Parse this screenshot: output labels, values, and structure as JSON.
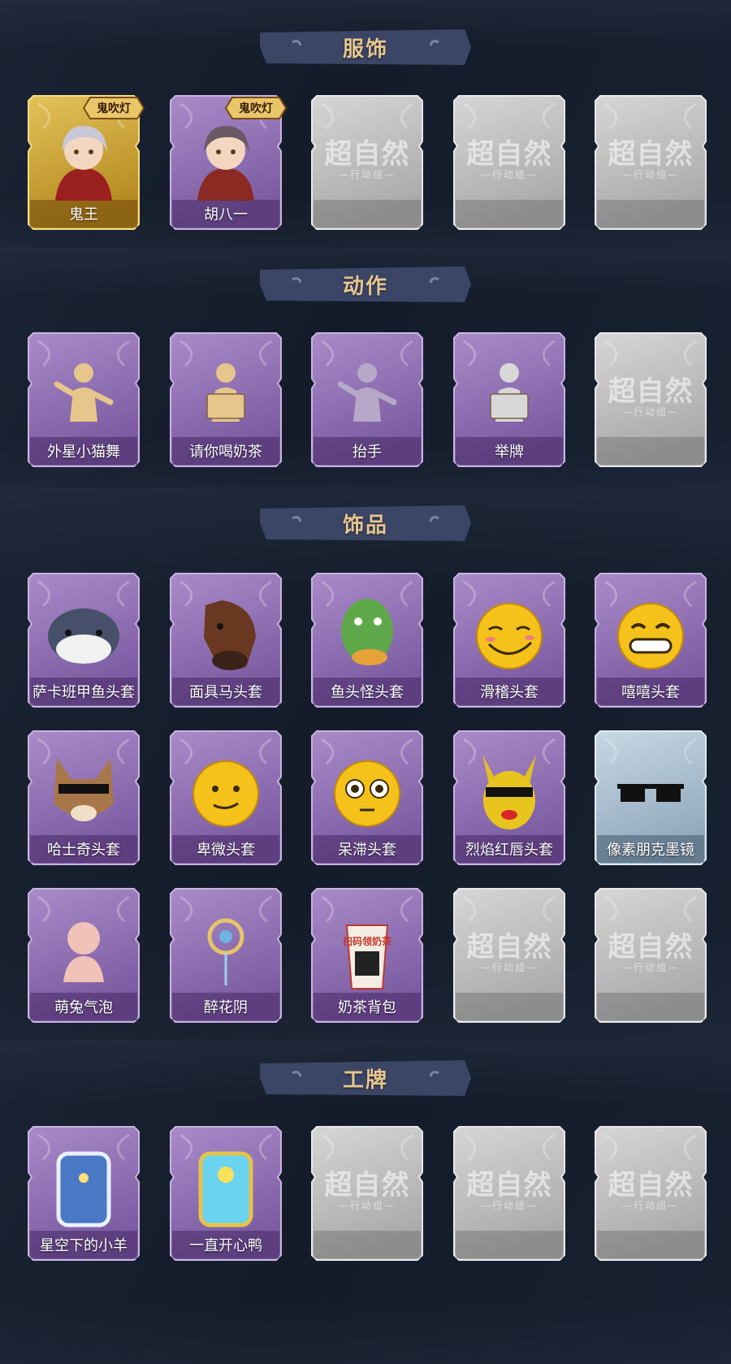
{
  "colors": {
    "background": "#141c2a",
    "title_gold": "#e8c690",
    "purple_card": "#8f6fb5",
    "gold_card": "#c99a2e",
    "blue_card": "#a9bfd0",
    "gray_card": "#c9c9c9"
  },
  "locked_watermark": {
    "main": "超自然",
    "sub": "—行动组—"
  },
  "sections": [
    {
      "title": "服饰",
      "items": [
        {
          "label": "鬼王",
          "style": "gold",
          "icon": "character-ghost-king-icon",
          "badge": "鬼吹灯"
        },
        {
          "label": "胡八一",
          "style": "purple",
          "icon": "character-hu-bayi-icon",
          "badge": "鬼吹灯"
        },
        {
          "label": "",
          "style": "locked"
        },
        {
          "label": "",
          "style": "locked"
        },
        {
          "label": "",
          "style": "locked"
        }
      ]
    },
    {
      "title": "动作",
      "items": [
        {
          "label": "外星小猫舞",
          "style": "purple",
          "icon": "dance-pose-icon"
        },
        {
          "label": "请你喝奶茶",
          "style": "purple",
          "icon": "hold-sign-pose-icon"
        },
        {
          "label": "抬手",
          "style": "purple",
          "icon": "raise-hand-pose-icon"
        },
        {
          "label": "举牌",
          "style": "purple",
          "icon": "hold-placard-pose-icon"
        },
        {
          "label": "",
          "style": "locked"
        }
      ]
    },
    {
      "title": "饰品",
      "items": [
        {
          "label": "萨卡班甲鱼头套",
          "style": "purple",
          "icon": "fish-head-mask-icon"
        },
        {
          "label": "面具马头套",
          "style": "purple",
          "icon": "horse-head-mask-icon"
        },
        {
          "label": "鱼头怪头套",
          "style": "purple",
          "icon": "green-fish-mask-icon"
        },
        {
          "label": "滑稽头套",
          "style": "purple",
          "icon": "funny-face-mask-icon"
        },
        {
          "label": "嘻嘻头套",
          "style": "purple",
          "icon": "grin-face-mask-icon"
        },
        {
          "label": "哈士奇头套",
          "style": "purple",
          "icon": "husky-mask-icon"
        },
        {
          "label": "卑微头套",
          "style": "purple",
          "icon": "humble-face-mask-icon"
        },
        {
          "label": "呆滞头套",
          "style": "purple",
          "icon": "dazed-face-mask-icon"
        },
        {
          "label": "烈焰红唇头套",
          "style": "purple",
          "icon": "pikachu-mask-icon"
        },
        {
          "label": "像素朋克墨镜",
          "style": "blue",
          "icon": "pixel-sunglasses-icon"
        },
        {
          "label": "萌兔气泡",
          "style": "purple",
          "icon": "bunny-bubble-icon"
        },
        {
          "label": "醉花阴",
          "style": "purple",
          "icon": "flower-ornament-icon"
        },
        {
          "label": "奶茶背包",
          "style": "purple",
          "icon": "milk-tea-backpack-icon",
          "icon_text": "扫码领奶茶"
        },
        {
          "label": "",
          "style": "locked"
        },
        {
          "label": "",
          "style": "locked"
        }
      ]
    },
    {
      "title": "工牌",
      "items": [
        {
          "label": "星空下的小羊",
          "style": "purple",
          "icon": "starry-sheep-badge-icon"
        },
        {
          "label": "一直开心鸭",
          "style": "purple",
          "icon": "happy-duck-badge-icon"
        },
        {
          "label": "",
          "style": "locked"
        },
        {
          "label": "",
          "style": "locked"
        },
        {
          "label": "",
          "style": "locked"
        }
      ]
    }
  ]
}
